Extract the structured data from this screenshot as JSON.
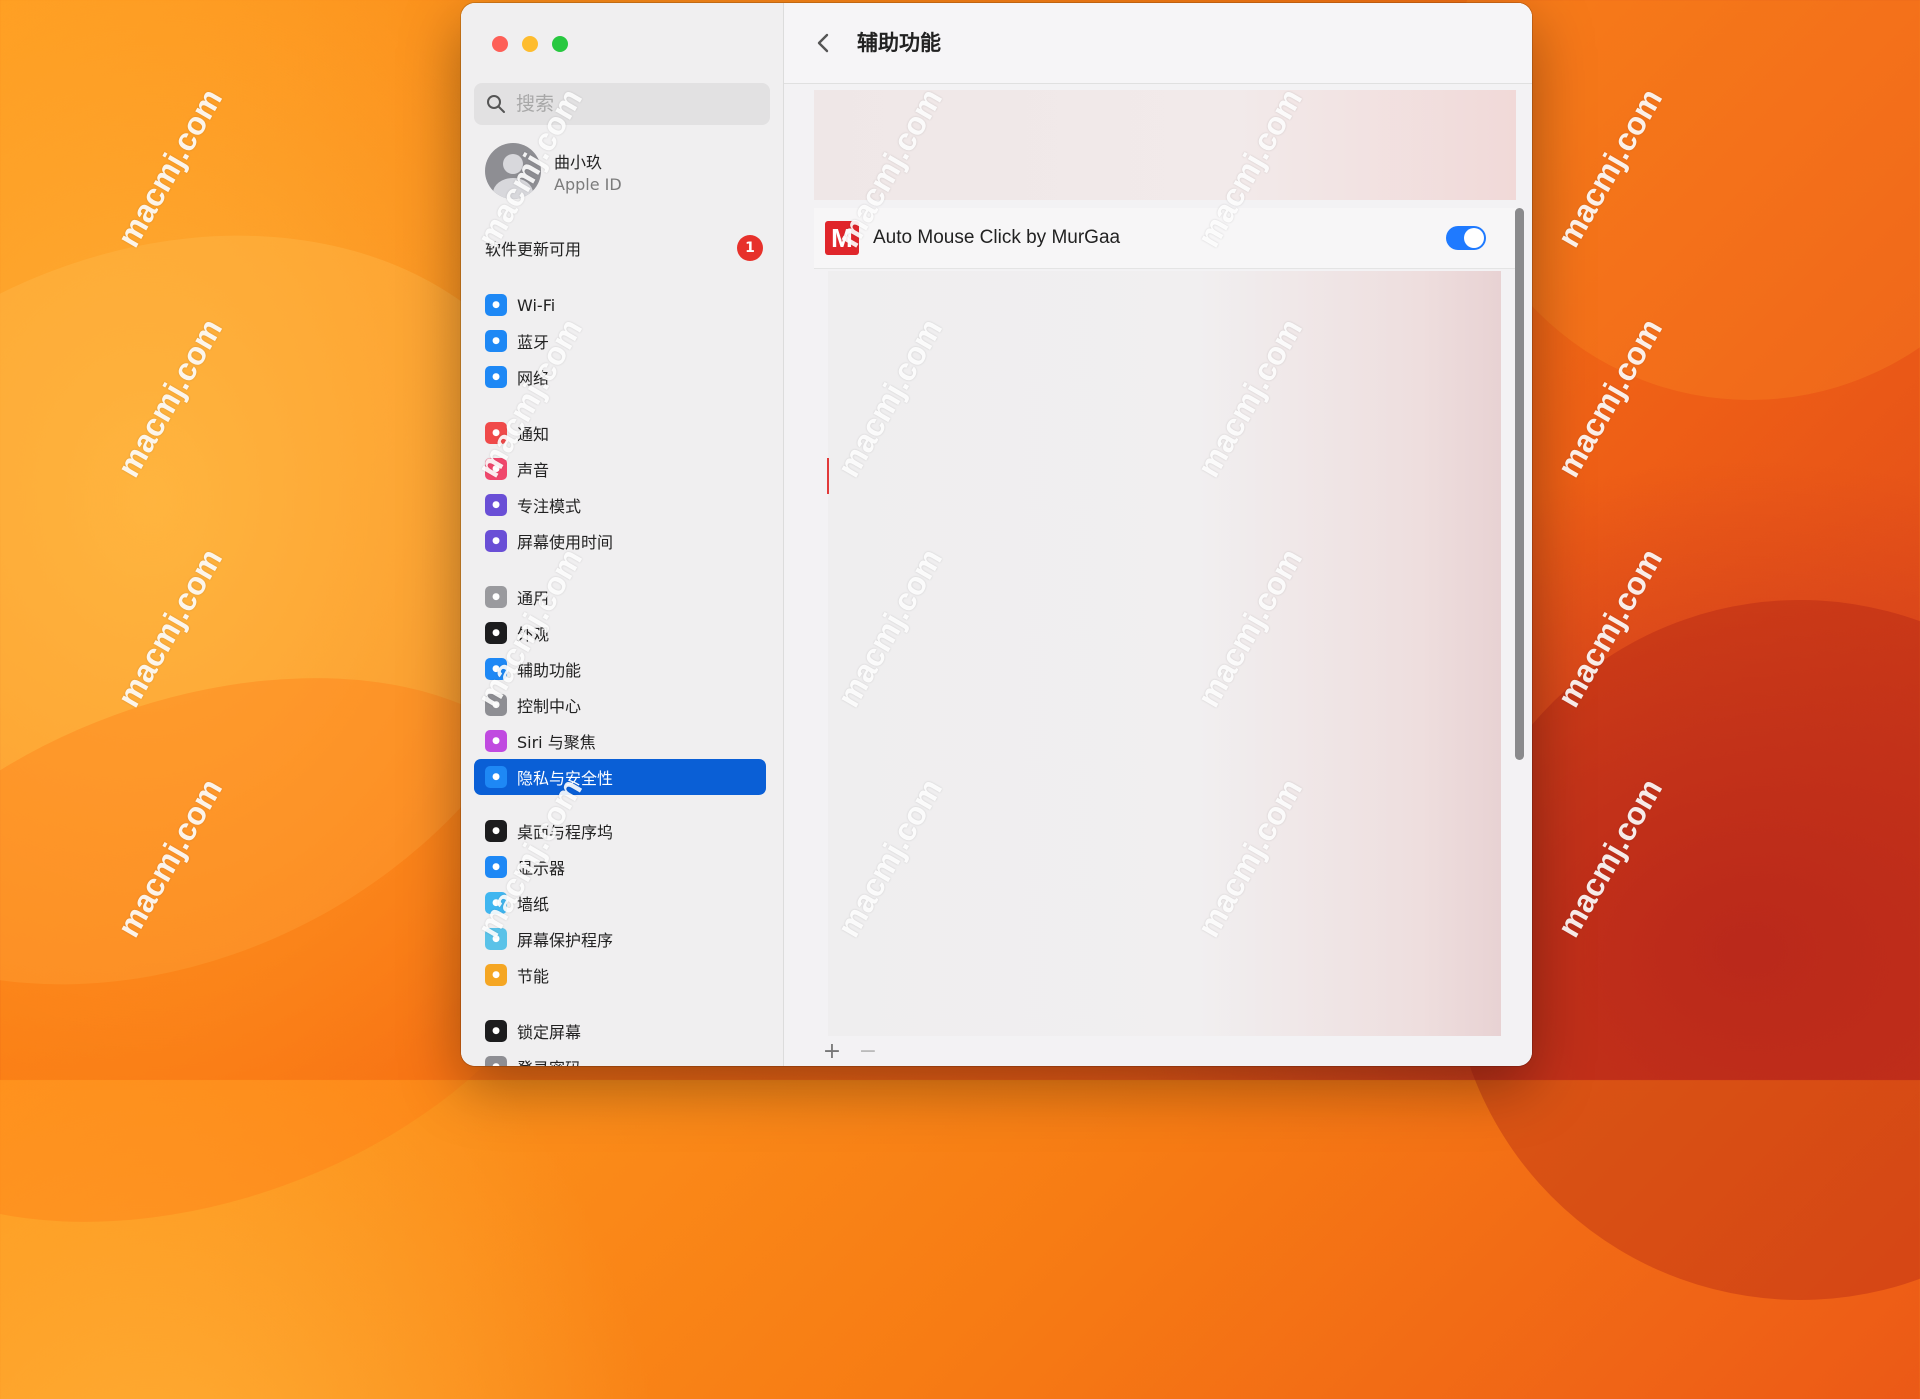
{
  "window": {
    "title": "辅助功能",
    "back_label": "<"
  },
  "sidebar": {
    "search_placeholder": "搜索",
    "account": {
      "name": "曲小玖",
      "subtitle": "Apple ID"
    },
    "update": {
      "label": "软件更新可用",
      "badge": "1"
    },
    "groups": [
      [
        {
          "label": "Wi-Fi",
          "icon": "wifi-icon",
          "color": "#1e88f5"
        },
        {
          "label": "蓝牙",
          "icon": "bluetooth-icon",
          "color": "#1e88f5"
        },
        {
          "label": "网络",
          "icon": "globe-icon",
          "color": "#1e88f5"
        }
      ],
      [
        {
          "label": "通知",
          "icon": "bell-icon",
          "color": "#f04a4a"
        },
        {
          "label": "声音",
          "icon": "speaker-icon",
          "color": "#f0476c"
        },
        {
          "label": "专注模式",
          "icon": "moon-icon",
          "color": "#6a4fd6"
        },
        {
          "label": "屏幕使用时间",
          "icon": "hourglass-icon",
          "color": "#6a4fd6"
        }
      ],
      [
        {
          "label": "通用",
          "icon": "gear-icon",
          "color": "#9a9a9e"
        },
        {
          "label": "外观",
          "icon": "appearance-icon",
          "color": "#1c1c1e"
        },
        {
          "label": "辅助功能",
          "icon": "accessibility-icon",
          "color": "#1e88f5"
        },
        {
          "label": "控制中心",
          "icon": "control-center-icon",
          "color": "#8e8e93"
        },
        {
          "label": "Siri 与聚焦",
          "icon": "siri-icon",
          "color": "#c04ae0"
        },
        {
          "label": "隐私与安全性",
          "icon": "hand-icon",
          "color": "#1e88f5",
          "selected": true
        }
      ],
      [
        {
          "label": "桌面与程序坞",
          "icon": "dock-icon",
          "color": "#1c1c1e"
        },
        {
          "label": "显示器",
          "icon": "display-icon",
          "color": "#1e88f5"
        },
        {
          "label": "墙纸",
          "icon": "wallpaper-icon",
          "color": "#40b6f0"
        },
        {
          "label": "屏幕保护程序",
          "icon": "screensaver-icon",
          "color": "#5ac2e8"
        },
        {
          "label": "节能",
          "icon": "lightbulb-icon",
          "color": "#f5a623"
        }
      ],
      [
        {
          "label": "锁定屏幕",
          "icon": "lock-icon",
          "color": "#1c1c1e"
        },
        {
          "label": "登录密码",
          "icon": "key-icon",
          "color": "#8e8e93"
        }
      ]
    ]
  },
  "main": {
    "app": {
      "name": "Auto Mouse Click by MurGaa",
      "icon_letter": "M",
      "enabled": true
    },
    "add_label": "+",
    "remove_label": "−"
  },
  "watermark": "macmj.com"
}
